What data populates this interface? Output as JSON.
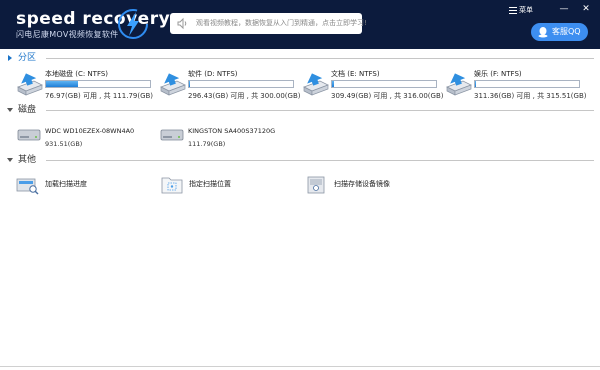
{
  "app": {
    "logo_title": "speed recovery",
    "logo_subtitle": "闪电尼康MOV视频恢复软件",
    "search_hint": "观看视频教程，数据恢复从入门到精通，点击立即学习!",
    "menu_label": "菜单",
    "minimize_symbol": "—",
    "close_symbol": "✕",
    "qq_label": "客服QQ"
  },
  "colors": {
    "header_bg": "#0c1b3d",
    "accent": "#1a73c8",
    "qq_button": "#3d8ef0",
    "usage_fill": "#1f7fd8"
  },
  "sections": {
    "partitions": "分区",
    "disks": "磁盘",
    "others": "其他"
  },
  "partitions": [
    {
      "name": "本地磁盘 (C: NTFS)",
      "capacity": "76.97(GB) 可用 , 共 111.79(GB)",
      "used_fraction": 0.31,
      "icon": "drive-c-icon"
    },
    {
      "name": "软件 (D: NTFS)",
      "capacity": "296.43(GB) 可用 , 共 300.00(GB)",
      "used_fraction": 0.012,
      "icon": "drive-d-icon"
    },
    {
      "name": "文档 (E: NTFS)",
      "capacity": "309.49(GB) 可用 , 共 316.00(GB)",
      "used_fraction": 0.021,
      "icon": "drive-e-icon"
    },
    {
      "name": "娱乐 (F: NTFS)",
      "capacity": "311.36(GB) 可用 , 共 315.51(GB)",
      "used_fraction": 0.013,
      "icon": "drive-f-icon"
    }
  ],
  "disks": [
    {
      "name": "WDC WD10EZEX-08WN4A0",
      "capacity": "931.51(GB)",
      "icon": "hard-disk-icon"
    },
    {
      "name": "KINGSTON SA400S37120G",
      "capacity": "111.79(GB)",
      "icon": "hard-disk-icon"
    }
  ],
  "others": [
    {
      "label": "加载扫描进度",
      "icon": "load-scan-progress-icon"
    },
    {
      "label": "指定扫描位置",
      "icon": "specify-scan-location-icon"
    },
    {
      "label": "扫描存储设备镜像",
      "icon": "scan-device-image-icon"
    }
  ]
}
